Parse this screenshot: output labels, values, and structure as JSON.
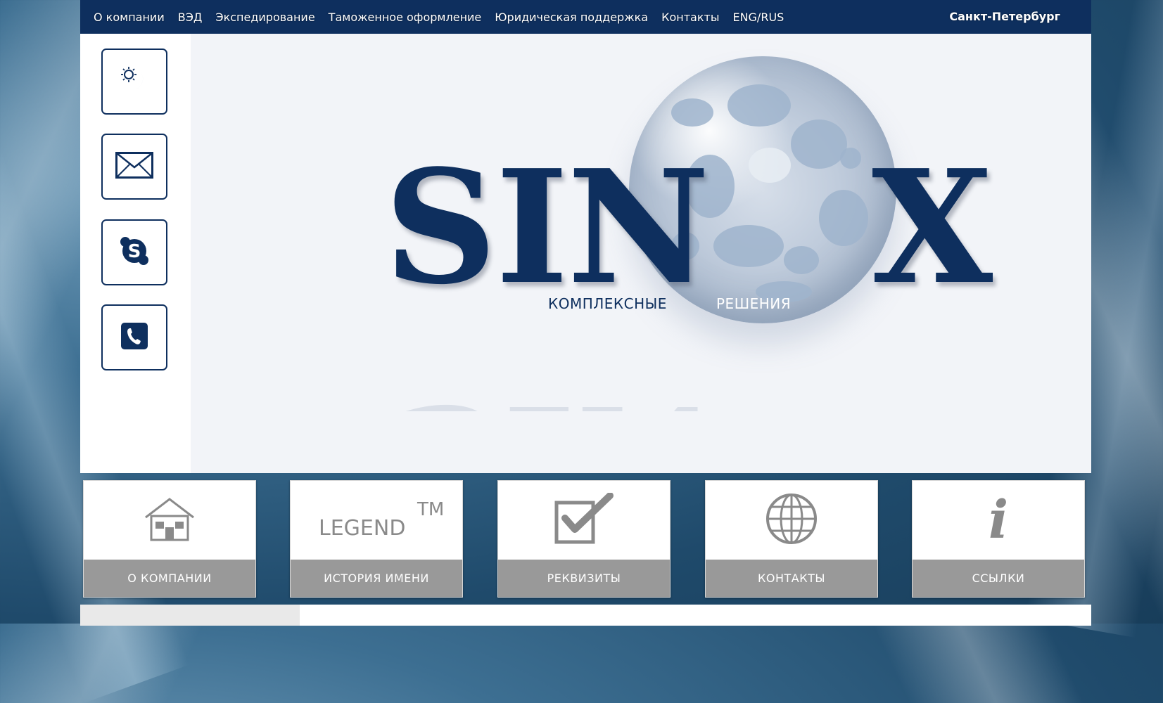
{
  "nav": {
    "items": [
      {
        "label": "О компании"
      },
      {
        "label": "ВЭД"
      },
      {
        "label": "Экспедирование"
      },
      {
        "label": "Таможенное оформление"
      },
      {
        "label": "Юридическая поддержка"
      },
      {
        "label": "Контакты"
      },
      {
        "label": "ENG/RUS"
      }
    ],
    "city": "Санкт-Петербург"
  },
  "sidebar": {
    "buttons": [
      {
        "icon": "day-night-icon"
      },
      {
        "icon": "envelope-icon"
      },
      {
        "icon": "skype-icon"
      },
      {
        "icon": "phone-icon"
      }
    ]
  },
  "logo": {
    "part1": "SIN",
    "part2": "X",
    "tagline_left": "КОМПЛЕКСНЫЕ",
    "tagline_right": "РЕШЕНИЯ",
    "colors": {
      "brand": "#0e2f5e",
      "sphere": "#c0ccdc"
    }
  },
  "tiles": [
    {
      "label": "О КОМПАНИИ",
      "icon": "house-icon"
    },
    {
      "label": "ИСТОРИЯ ИМЕНИ",
      "icon": "legend-tm-icon",
      "icon_text": "LEGEND",
      "icon_sup": "TM"
    },
    {
      "label": "РЕКВИЗИТЫ",
      "icon": "checkbox-icon"
    },
    {
      "label": "КОНТАКТЫ",
      "icon": "globe-icon"
    },
    {
      "label": "ССЫЛКИ",
      "icon": "info-icon",
      "icon_text": "i"
    }
  ]
}
